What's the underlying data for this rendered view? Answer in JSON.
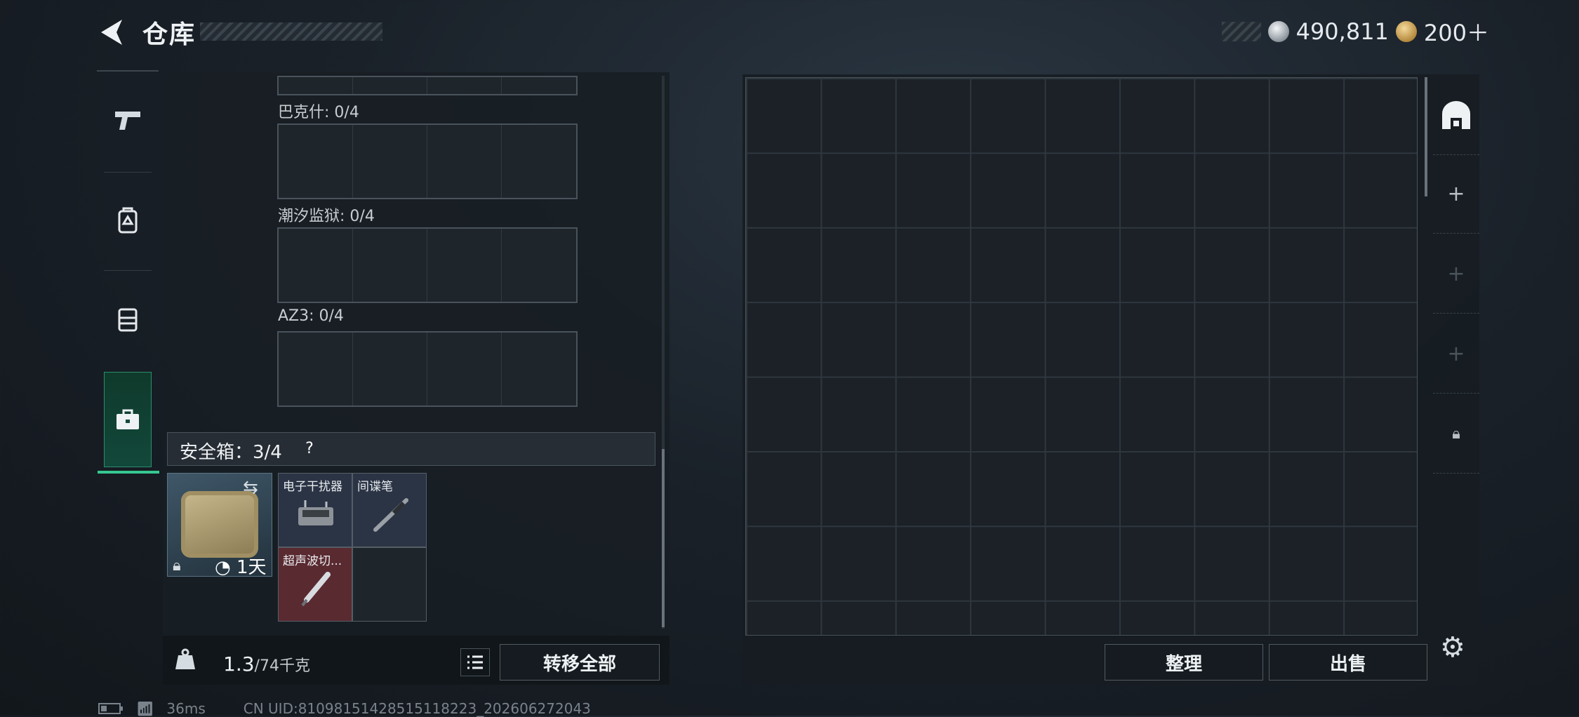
{
  "header": {
    "title": "仓库",
    "silver": "490,811",
    "gold": "200＋"
  },
  "rail": {
    "tabs": [
      "pistol-icon",
      "backpack-icon",
      "chest-rig-icon",
      "briefcase-icon"
    ],
    "active": 3
  },
  "lpanel": {
    "sections": [
      {
        "label": "巴克什: 0/4"
      },
      {
        "label": "潮汐监狱: 0/4"
      },
      {
        "label": "AZ3: 0/4"
      }
    ],
    "safe": {
      "label": "安全箱：3/4",
      "help": "?",
      "duration": "1天",
      "items": [
        {
          "name": "电子干扰器"
        },
        {
          "name": "间谍笔"
        },
        {
          "name": "超声波切..."
        }
      ]
    },
    "weight": {
      "value": "1.3",
      "unit": "/74千克"
    },
    "transfer_all": "转移全部"
  },
  "right": {
    "sort": "整理",
    "sell": "出售",
    "side": [
      "base-icon",
      "plus-icon",
      "plus-icon",
      "plus-icon",
      "lock-icon"
    ]
  },
  "status": {
    "ping": "36ms",
    "uid": "CN UID:81098151428515118223_202606272043"
  },
  "colors": {
    "accent": "#36c792",
    "red_item": "#5a2a31",
    "blue_item": "#2b3445"
  }
}
